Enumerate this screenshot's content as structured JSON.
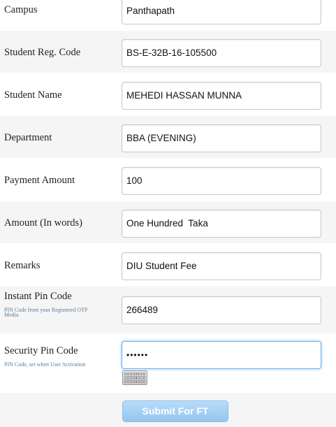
{
  "form": {
    "campus": {
      "label": "Campus",
      "value": "Panthapath"
    },
    "reg_code": {
      "label": "Student Reg. Code",
      "value": "BS-E-32B-16-105500"
    },
    "student_name": {
      "label": "Student Name",
      "value": "MEHEDI HASSAN MUNNA"
    },
    "department": {
      "label": "Department",
      "value": "BBA (EVENING)"
    },
    "payment_amount": {
      "label": "Payment Amount",
      "value": "100"
    },
    "amount_words": {
      "label": "Amount (In words)",
      "value": "One Hundred  Taka"
    },
    "remarks": {
      "label": "Remarks",
      "value": "DIU Student Fee"
    },
    "instant_pin": {
      "label": "Instant Pin Code",
      "hint": "PIN Code from your Registered OTP Media",
      "value": "266489"
    },
    "security_pin": {
      "label": "Security Pin Code",
      "hint": "PIN Code, set when User Activation",
      "value": "••••••"
    }
  },
  "icons": {
    "virtual_keyboard": "keyboard-icon"
  },
  "submit_label": "Submit For FT",
  "colors": {
    "row_alt": "#f5f5f5",
    "hint_text": "#5a7a99",
    "focus_border": "#6fb1e8",
    "submit_bg": "#a9d2f5"
  }
}
